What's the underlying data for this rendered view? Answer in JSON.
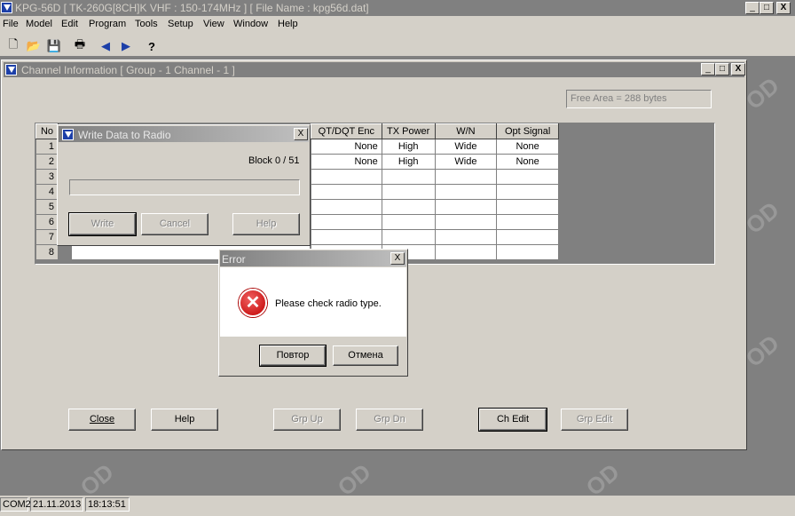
{
  "app": {
    "title": "KPG-56D  [ TK-260G[8CH]K VHF : 150-174MHz ] [ File Name : kpg56d.dat]",
    "controls": [
      "_",
      "□",
      "X"
    ]
  },
  "menu": [
    "File",
    "Model",
    "Edit",
    "Program",
    "Tools",
    "Setup",
    "View",
    "Window",
    "Help"
  ],
  "toolbar": [
    "new-icon",
    "open-icon",
    "save-icon",
    "print-icon",
    "read-radio-icon",
    "write-radio-icon",
    "help-icon"
  ],
  "toolbar_glyphs": [
    "🗋",
    "📂",
    "💾",
    "🖶",
    "◀",
    "▶",
    "?"
  ],
  "channel_window": {
    "title": "Channel Information [ Group - 1  Channel - 1 ]",
    "free_area": "Free Area = 288  bytes",
    "buttons": {
      "close": "Close",
      "help": "Help",
      "grp_up": "Grp Up",
      "grp_dn": "Grp Dn",
      "ch_edit": "Ch Edit",
      "grp_edit": "Grp Edit"
    }
  },
  "table": {
    "no_header": "No",
    "columns": [
      "QT/DQT Enc",
      "TX Power",
      "W/N",
      "Opt Signal"
    ],
    "row_numbers": [
      "1",
      "2",
      "3",
      "4",
      "5",
      "6",
      "7",
      "8"
    ],
    "rows": [
      [
        "None",
        "High",
        "Wide",
        "None"
      ],
      [
        "None",
        "High",
        "Wide",
        "None"
      ],
      [
        "",
        "",
        "",
        ""
      ],
      [
        "",
        "",
        "",
        ""
      ],
      [
        "",
        "",
        "",
        ""
      ],
      [
        "",
        "",
        "",
        ""
      ],
      [
        "",
        "",
        "",
        ""
      ],
      [
        "",
        "",
        "",
        ""
      ]
    ]
  },
  "write_dialog": {
    "title": "Write Data to Radio",
    "close": "X",
    "block": "Block 0 / 51",
    "progress": 0,
    "buttons": {
      "write": "Write",
      "cancel": "Cancel",
      "help": "Help"
    }
  },
  "error_dialog": {
    "title": "Error",
    "close": "X",
    "message": "Please check radio type.",
    "buttons": {
      "retry": "Повтор",
      "cancel": "Отмена"
    }
  },
  "statusbar": {
    "port": "COM2",
    "date": "21.11.2013",
    "time": "18:13:51"
  }
}
